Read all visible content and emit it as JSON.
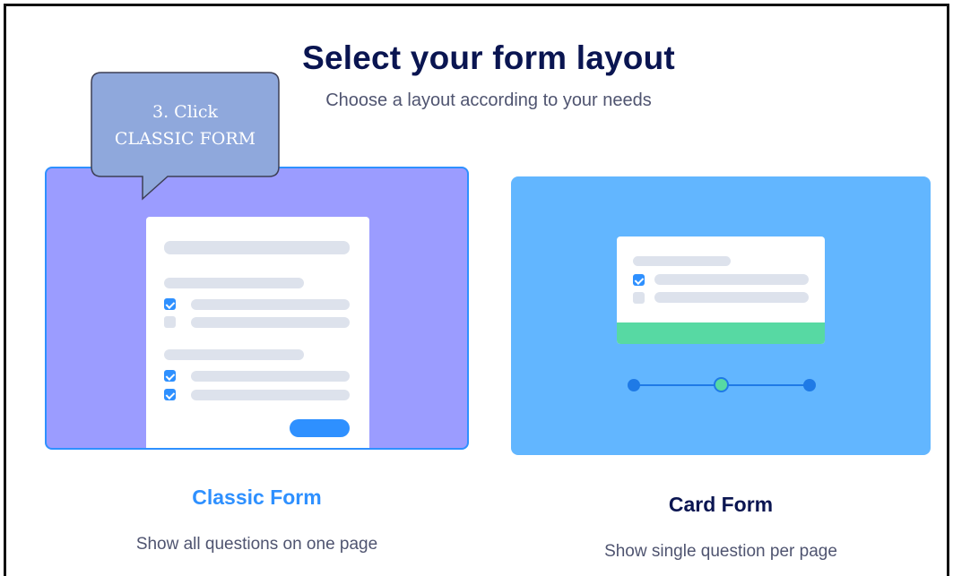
{
  "header": {
    "title": "Select your form layout",
    "subtitle": "Choose a layout according to your needs"
  },
  "options": [
    {
      "label": "Classic Form",
      "description": "Show all questions on one page",
      "selected": true
    },
    {
      "label": "Card Form",
      "description": "Show single question per page",
      "selected": false
    }
  ],
  "callout": {
    "line1": "3. Click",
    "line2": "CLASSIC FORM"
  },
  "colors": {
    "title": "#0a1551",
    "classic_bg": "#9b9cff",
    "card_bg": "#62b6ff",
    "accent_blue": "#2e90ff",
    "accent_green": "#57d9a3",
    "callout_fill": "#8fa8dc"
  },
  "icons": [
    "checkbox-checked-icon",
    "checkbox-empty-icon",
    "progress-dot-icon"
  ]
}
